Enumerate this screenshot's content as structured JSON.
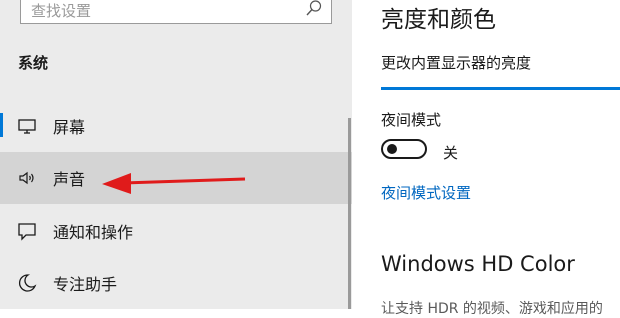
{
  "search": {
    "placeholder": "查找设置",
    "icon": "search-icon"
  },
  "sidebar": {
    "section_title": "系统",
    "items": [
      {
        "label": "屏幕",
        "icon": "monitor-icon"
      },
      {
        "label": "声音",
        "icon": "speaker-icon"
      },
      {
        "label": "通知和操作",
        "icon": "notification-icon"
      },
      {
        "label": "专注助手",
        "icon": "moon-icon"
      }
    ]
  },
  "main": {
    "title": "亮度和颜色",
    "brightness_label": "更改内置显示器的亮度",
    "night_mode_label": "夜间模式",
    "night_mode_state": "关",
    "night_mode_link": "夜间模式设置",
    "hd_color_title": "Windows HD Color",
    "cut_text": "让支持 HDR 的视频、游戏和应用的"
  },
  "colors": {
    "accent": "#0078d7",
    "link": "#0067c0",
    "annotation_arrow": "#e01b1b"
  }
}
